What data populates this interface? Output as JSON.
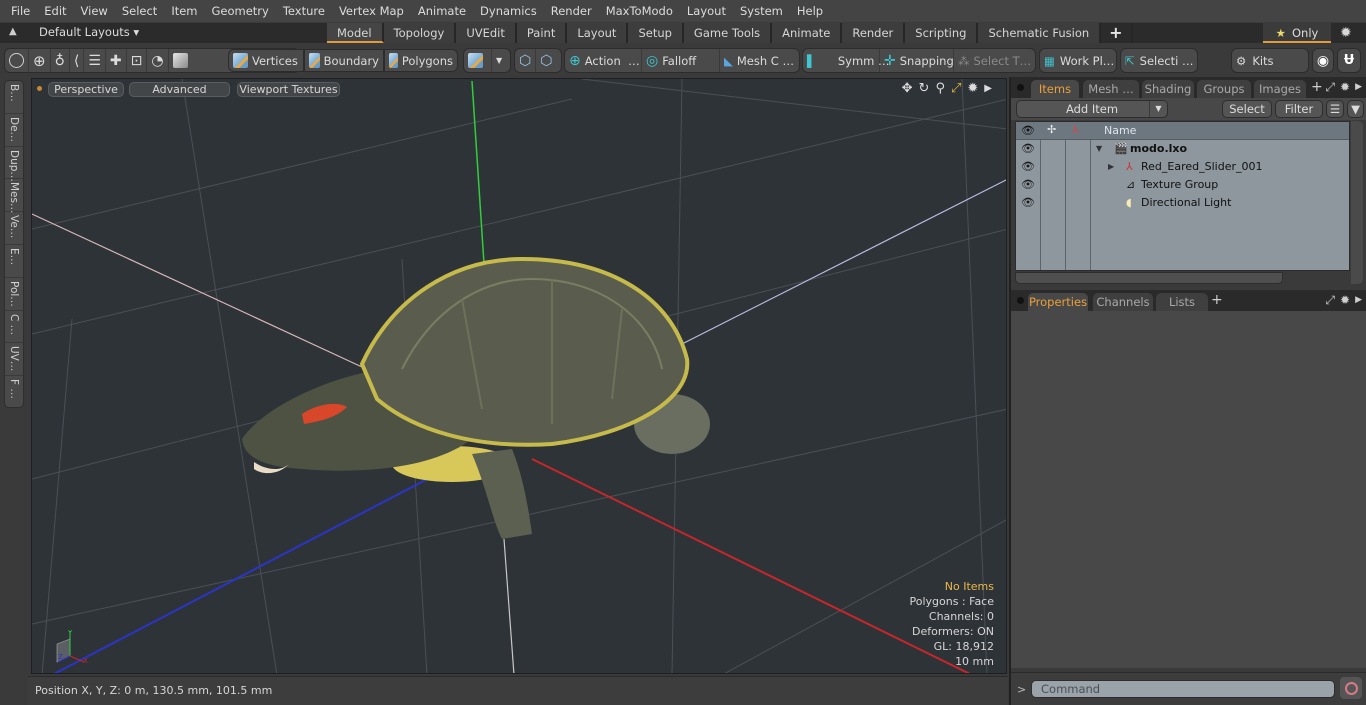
{
  "menu": [
    "File",
    "Edit",
    "View",
    "Select",
    "Item",
    "Geometry",
    "Texture",
    "Vertex Map",
    "Animate",
    "Dynamics",
    "Render",
    "MaxToModo",
    "Layout",
    "System",
    "Help"
  ],
  "layout_bar": {
    "layouts_label": "Default Layouts",
    "tabs": [
      "Model",
      "Topology",
      "UVEdit",
      "Paint",
      "Layout",
      "Setup",
      "Game Tools",
      "Animate",
      "Render",
      "Scripting",
      "Schematic Fusion"
    ],
    "active_tab": "Model",
    "add_tab": "+",
    "only_label": "Only"
  },
  "toolbar": {
    "vertices": "Vertices",
    "boundary": "Boundary",
    "polygons": "Polygons",
    "action": "Action",
    "action_more": "…",
    "falloff": "Falloff",
    "mesh_c": "Mesh C …",
    "symm": "Symm …",
    "snapping": "Snapping",
    "select_t": "Select T…",
    "work_pl": "Work Pl…",
    "selecti": "Selecti …",
    "kits": "Kits"
  },
  "left_tabs": [
    "B…",
    "De…",
    "Dup…",
    "Mes…",
    "Ve…",
    "E…",
    "Pol…",
    "C …",
    "UV…",
    "F …"
  ],
  "viewport": {
    "view_mode": "Perspective",
    "shading": "Advanced",
    "textures": "Viewport Textures",
    "info": {
      "selection": "No Items",
      "polygons": "Polygons : Face",
      "channels": "Channels: 0",
      "deformers": "Deformers: ON",
      "gl": "GL: 18,912",
      "grid": "10 mm"
    },
    "axis_labels": {
      "x": "X",
      "y": "Y",
      "z": "Z"
    }
  },
  "status": {
    "position": "Position X, Y, Z:   0 m, 130.5 mm, 101.5 mm"
  },
  "right_panel": {
    "top_tabs": [
      "Items",
      "Mesh …",
      "Shading",
      "Groups",
      "Images"
    ],
    "active_top_tab": "Items",
    "add_item": "Add Item",
    "select": "Select",
    "filter": "Filter",
    "tree_header": "Name",
    "tree": [
      {
        "label": "modo.lxo",
        "bold": true,
        "expanded": true
      },
      {
        "label": "Red_Eared_Slider_001",
        "bold": false,
        "expanded": false
      },
      {
        "label": "Texture Group",
        "bold": false
      },
      {
        "label": "Directional Light",
        "bold": false
      }
    ],
    "bottom_tabs": [
      "Properties",
      "Channels",
      "Lists"
    ],
    "active_bottom_tab": "Properties",
    "add_tab": "+",
    "command_placeholder": "Command",
    "command_prompt": ">"
  },
  "colors": {
    "accent": "#e39a3a",
    "viewport_bg": "#2e3338",
    "x_axis": "#c8262a",
    "y_axis": "#2fcf3a",
    "z_axis": "#2a35c8",
    "info_highlight": "#e9b84a"
  }
}
